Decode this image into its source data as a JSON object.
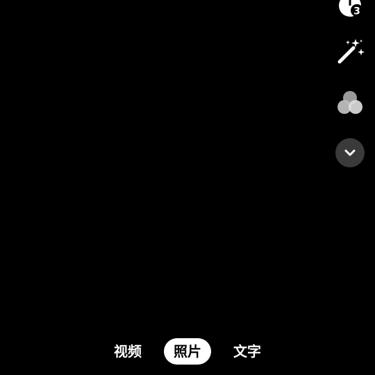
{
  "camera": {
    "timer_badge": "3",
    "icons": {
      "timer": "timer-icon",
      "beauty": "magic-wand-icon",
      "filter": "filter-circles-icon",
      "expand": "chevron-down-icon"
    }
  },
  "modes": [
    {
      "label": "视频",
      "selected": false
    },
    {
      "label": "照片",
      "selected": true
    },
    {
      "label": "文字",
      "selected": false
    }
  ],
  "colors": {
    "background": "#000000",
    "icon": "#ffffff",
    "expand_button_bg": "#3a3a3a",
    "selected_pill": "#ffffff"
  }
}
